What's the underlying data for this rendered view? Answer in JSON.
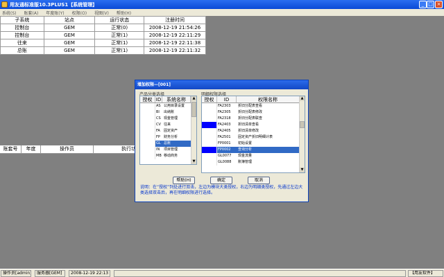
{
  "window": {
    "title": "用友通标准版10.3PLUS1【系统管理】",
    "min": "_",
    "max": "□",
    "close": "×"
  },
  "menu": [
    "系统(S)",
    "账套(A)",
    "年度账(Y)",
    "权限(O)",
    "视图(V)",
    "帮助(H)"
  ],
  "top_grid": {
    "headers": [
      "子系统",
      "站点",
      "运行状态",
      "注册时间"
    ],
    "rows": [
      [
        "控制台",
        "GEM",
        "正常(0)",
        "2008-12-19 21:54:26"
      ],
      [
        "控制台",
        "GEM",
        "正常(1)",
        "2008-12-19 22:11:29"
      ],
      [
        "往来",
        "GEM",
        "正常(1)",
        "2008-12-19 22:11:38"
      ],
      [
        "总账",
        "GEM",
        "正常(1)",
        "2008-12-19 22:11:32"
      ]
    ]
  },
  "bottom_grid": {
    "headers": [
      "账套号",
      "年度",
      "操作员",
      "执行功"
    ]
  },
  "dialog": {
    "title": "增加权限—[001]",
    "left_label": "产品分类选择",
    "right_label": "明细权限选择",
    "left_headers": [
      "授权",
      "ID",
      "系统名称"
    ],
    "left_rows": [
      {
        "id": "AS",
        "name": "公用目录设置",
        "on": false,
        "sel": false
      },
      {
        "id": "BI",
        "name": "出纳账",
        "on": false,
        "sel": false
      },
      {
        "id": "CS",
        "name": "现金管理",
        "on": false,
        "sel": false
      },
      {
        "id": "CV",
        "name": "往来",
        "on": false,
        "sel": false
      },
      {
        "id": "FA",
        "name": "固定资产",
        "on": false,
        "sel": false
      },
      {
        "id": "FP",
        "name": "财务分析",
        "on": false,
        "sel": false
      },
      {
        "id": "GL",
        "name": "总账",
        "on": false,
        "sel": true
      },
      {
        "id": "IN",
        "name": "项目管理",
        "on": false,
        "sel": false
      },
      {
        "id": "MB",
        "name": "移动商务",
        "on": false,
        "sel": false
      }
    ],
    "right_headers": [
      "授权",
      "ID",
      "权限名称"
    ],
    "right_rows": [
      {
        "id": "FA2303",
        "name": "折旧分配表查看",
        "on": false,
        "sel": false
      },
      {
        "id": "FA2305",
        "name": "折旧分配表修改",
        "on": false,
        "sel": false
      },
      {
        "id": "FA2318",
        "name": "折旧分配表联查",
        "on": false,
        "sel": false
      },
      {
        "id": "FA2403",
        "name": "折旧清单查看",
        "on": true,
        "sel": false
      },
      {
        "id": "FA2405",
        "name": "折旧清单修改",
        "on": false,
        "sel": false
      },
      {
        "id": "FA2501",
        "name": "固定资产折旧明细计表",
        "on": false,
        "sel": false
      },
      {
        "id": "FP0001",
        "name": "初始设置",
        "on": false,
        "sel": false
      },
      {
        "id": "FP0002",
        "name": "查询分析",
        "on": true,
        "sel": true
      },
      {
        "id": "GL0077",
        "name": "现金流量",
        "on": false,
        "sel": false
      },
      {
        "id": "GL0088",
        "name": "账簿管理",
        "on": false,
        "sel": false
      }
    ],
    "buttons": {
      "help": "帮助(H)",
      "ok": "确定",
      "cancel": "取消"
    },
    "note": "说明：在“授权”列处进行双击，左边为模块大类授权，右边为明细类授权，先通过左边大类选择双击后，再在明细权限进行选择。"
  },
  "status": {
    "operator": "操作员[admin]",
    "server": "服务器[GEM]",
    "datetime": "2008-12-19 22:13",
    "brand": "【用友软件】"
  },
  "colors": {
    "titlebar": "#0a4ad6",
    "selection": "#316ac5",
    "granted": "#0000ff",
    "note": "#0033cc",
    "background": "#808080"
  }
}
